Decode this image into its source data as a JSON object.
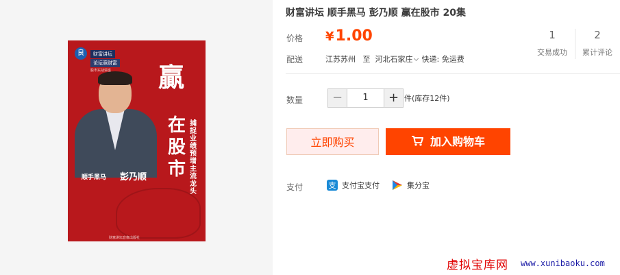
{
  "product": {
    "title": "财富讲坛 顺手黑马 彭乃顺 赢在股市 20集",
    "cover": {
      "badge": "良",
      "tag1": "财富讲坛",
      "tag2": "论坛竞财富",
      "tag3": "股市实战讲座",
      "big1": "贏",
      "big2": "在股市",
      "vertical_text": "捕捉业绩预增主流龙头",
      "series": "顺手黑马",
      "author": "彭乃顺",
      "publisher": "财富讲坛音像出版社"
    }
  },
  "price": {
    "label": "价格",
    "currency": "¥",
    "value": "1.00"
  },
  "stats": {
    "sales_count": "1",
    "sales_label": "交易成功",
    "reviews_count": "2",
    "reviews_label": "累计评论"
  },
  "shipping": {
    "label": "配送",
    "from": "江苏苏州",
    "to_word": "至",
    "to": "河北石家庄",
    "method": "快递: 免运费"
  },
  "quantity": {
    "label": "数量",
    "minus": "−",
    "value": "1",
    "plus": "+",
    "stock": "件(库存12件)"
  },
  "actions": {
    "buy_now": "立即购买",
    "add_to_cart": "加入购物车"
  },
  "payment": {
    "label": "支付",
    "alipay": "支付宝支付",
    "jifenbao": "集分宝"
  },
  "watermark": {
    "cn": "虚拟宝库网",
    "url": "www.xunibaoku.com"
  },
  "colors": {
    "accent": "#ff4400",
    "buy_bg": "#ffeded",
    "cover_red": "#b8181c"
  }
}
